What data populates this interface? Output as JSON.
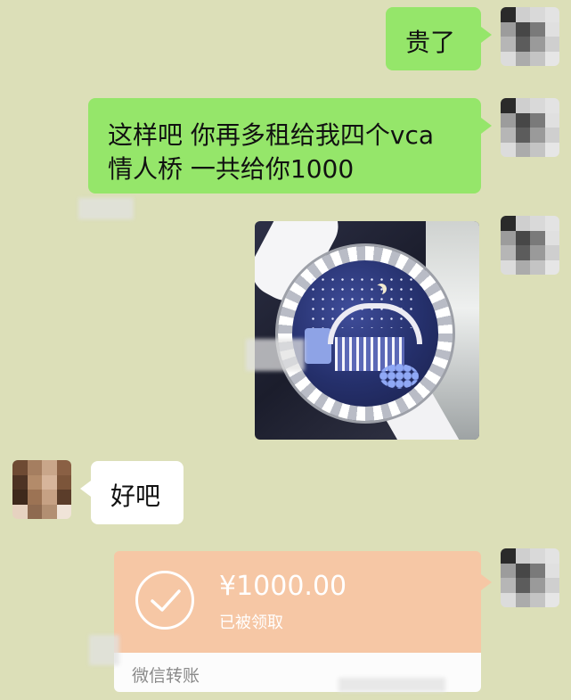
{
  "messages": {
    "m1": "贵了",
    "m2_line1": "这样吧 你再多租给我四个vca",
    "m2_line2": "情人桥 一共给你1000",
    "m4": "好吧"
  },
  "transfer": {
    "amount": "¥1000.00",
    "status": "已被领取",
    "label": "微信转账"
  },
  "colors": {
    "background": "#dcdfb8",
    "sent_bubble": "#95e66a",
    "received_bubble": "#ffffff",
    "transfer_card": "#f6c7a5"
  },
  "icons": [
    "check-icon"
  ]
}
